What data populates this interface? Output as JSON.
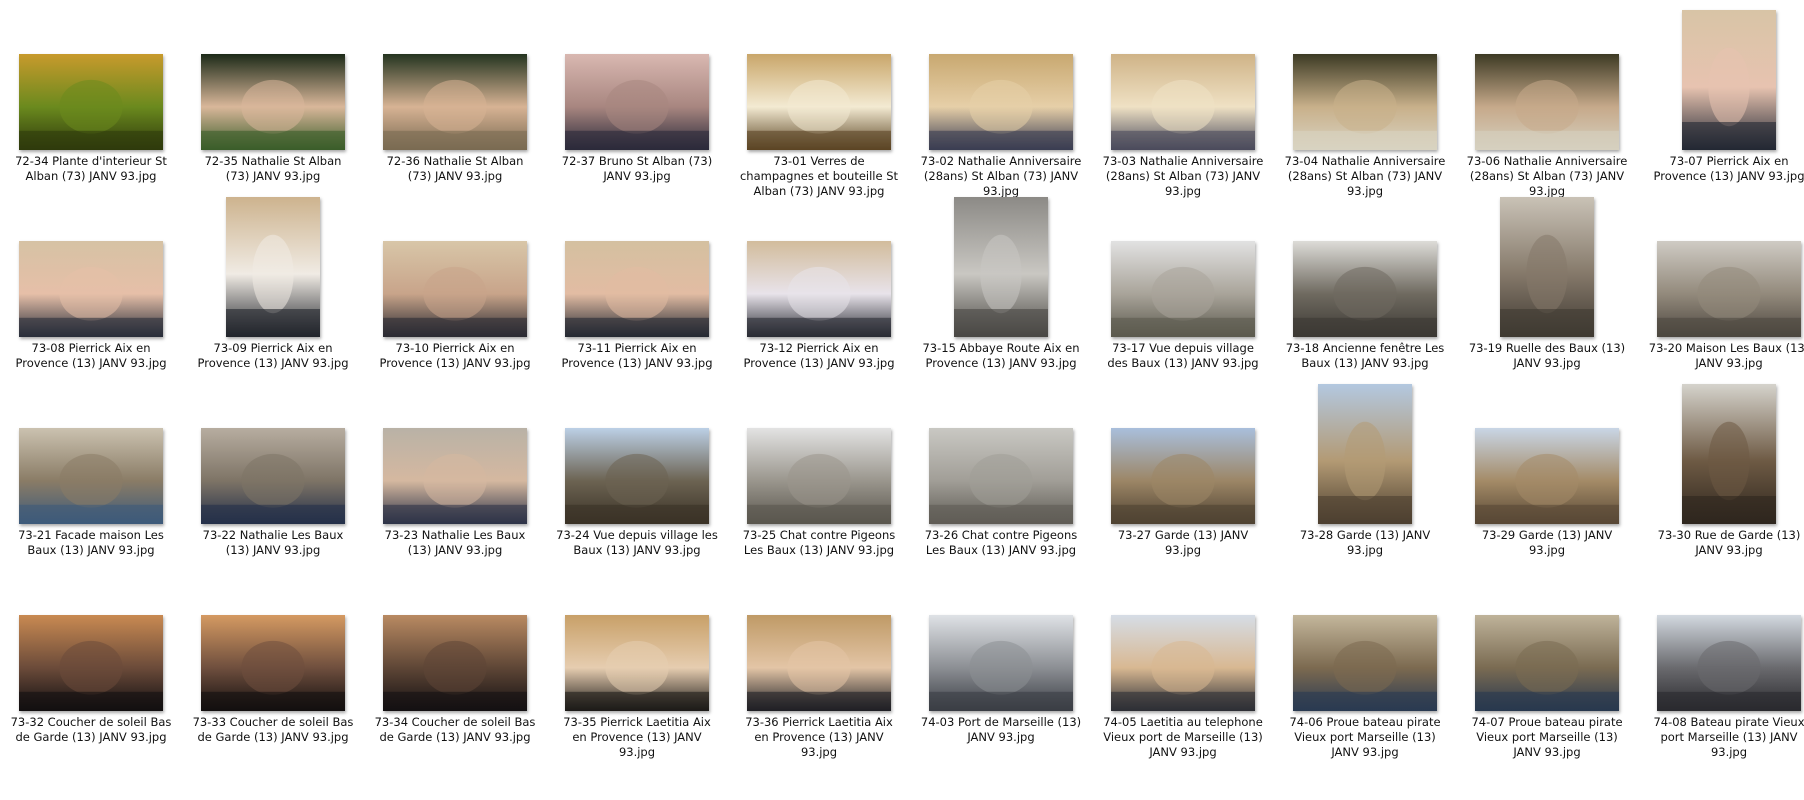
{
  "files": [
    {
      "name": "72-34 Plante d'interieur St Alban (73) JANV 93.jpg",
      "orientation": "landscape",
      "palette": [
        "#c89a2c",
        "#6b8a1e",
        "#2f3a0c"
      ]
    },
    {
      "name": "72-35 Nathalie St Alban (73) JANV 93.jpg",
      "orientation": "landscape",
      "palette": [
        "#1c2a18",
        "#d9b79a",
        "#3b5d2a"
      ]
    },
    {
      "name": "72-36 Nathalie St Alban (73) JANV 93.jpg",
      "orientation": "landscape",
      "palette": [
        "#243420",
        "#d7b394",
        "#7a6a52"
      ]
    },
    {
      "name": "72-37 Bruno St Alban (73) JANV 93.jpg",
      "orientation": "landscape",
      "palette": [
        "#d9b8b1",
        "#a88680",
        "#2b2a3a"
      ]
    },
    {
      "name": "73-01 Verres de champagnes et bouteille St Alban (73) JANV 93.jpg",
      "orientation": "landscape",
      "palette": [
        "#c9a66a",
        "#f3ead2",
        "#5b4524"
      ]
    },
    {
      "name": "73-02 Nathalie Anniversaire (28ans) St Alban (73) JANV 93.jpg",
      "orientation": "landscape",
      "palette": [
        "#c8a870",
        "#e6cfa8",
        "#3b3d52"
      ]
    },
    {
      "name": "73-03 Nathalie Anniversaire (28ans) St Alban (73) JANV 93.jpg",
      "orientation": "landscape",
      "palette": [
        "#cfb387",
        "#efe1c4",
        "#4b4b5c"
      ]
    },
    {
      "name": "73-04 Nathalie Anniversaire (28ans) St Alban (73) JANV 93.jpg",
      "orientation": "landscape",
      "palette": [
        "#3c3a24",
        "#c8b08a",
        "#d9d3c2"
      ]
    },
    {
      "name": "73-06 Nathalie Anniversaire (28ans) St Alban (73) JANV 93.jpg",
      "orientation": "landscape",
      "palette": [
        "#3d3a24",
        "#c6a98a",
        "#d6d0bf"
      ]
    },
    {
      "name": "73-07 Pierrick Aix en Provence (13) JANV 93.jpg",
      "orientation": "portrait",
      "palette": [
        "#d8c4a6",
        "#e7c3b0",
        "#232833"
      ]
    },
    {
      "name": "73-08 Pierrick Aix en Provence (13) JANV 93.jpg",
      "orientation": "landscape",
      "palette": [
        "#d6c2a4",
        "#e6bfa8",
        "#2a2f3b"
      ]
    },
    {
      "name": "73-09 Pierrick Aix en Provence (13) JANV 93.jpg",
      "orientation": "portrait",
      "palette": [
        "#cdb38e",
        "#f0ebe4",
        "#22252c"
      ]
    },
    {
      "name": "73-10 Pierrick Aix en Provence (13) JANV 93.jpg",
      "orientation": "landscape",
      "palette": [
        "#d8c6a8",
        "#c8a48a",
        "#2b2b33"
      ]
    },
    {
      "name": "73-11 Pierrick Aix en Provence (13) JANV 93.jpg",
      "orientation": "landscape",
      "palette": [
        "#d4c0a0",
        "#e2bca3",
        "#262a33"
      ]
    },
    {
      "name": "73-12 Pierrick Aix en Provence (13) JANV 93.jpg",
      "orientation": "landscape",
      "palette": [
        "#d2bc9c",
        "#e8e3ea",
        "#2a2c34"
      ]
    },
    {
      "name": "73-15 Abbaye Route Aix en Provence (13) JANV 93.jpg",
      "orientation": "portrait",
      "palette": [
        "#8c8a86",
        "#c9c7c2",
        "#4a4844"
      ]
    },
    {
      "name": "73-17 Vue depuis village des Baux (13) JANV 93.jpg",
      "orientation": "landscape",
      "palette": [
        "#e2e2e2",
        "#a9a49a",
        "#5c5a4e"
      ]
    },
    {
      "name": "73-18 Ancienne fenêtre Les Baux (13) JANV 93.jpg",
      "orientation": "landscape",
      "palette": [
        "#dddcd8",
        "#6f6a60",
        "#3c3934"
      ]
    },
    {
      "name": "73-19 Ruelle des Baux (13) JANV 93.jpg",
      "orientation": "portrait",
      "palette": [
        "#c9c2b6",
        "#85796a",
        "#3f3a32"
      ]
    },
    {
      "name": "73-20 Maison Les Baux (13) JANV 93.jpg",
      "orientation": "landscape",
      "palette": [
        "#cfcbc4",
        "#938a7c",
        "#4d4740"
      ]
    },
    {
      "name": "73-21 Facade maison Les Baux (13) JANV 93.jpg",
      "orientation": "landscape",
      "palette": [
        "#cbc2b0",
        "#8a7c66",
        "#3d5a7a"
      ]
    },
    {
      "name": "73-22 Nathalie Les Baux (13) JANV 93.jpg",
      "orientation": "landscape",
      "palette": [
        "#b7ada0",
        "#7e7466",
        "#24304a"
      ]
    },
    {
      "name": "73-23 Nathalie Les Baux (13) JANV 93.jpg",
      "orientation": "landscape",
      "palette": [
        "#b9b2a6",
        "#d5b8a0",
        "#2e3448"
      ]
    },
    {
      "name": "73-24 Vue depuis village les Baux (13) JANV 93.jpg",
      "orientation": "landscape",
      "palette": [
        "#bcd0e6",
        "#6c6352",
        "#3a3226"
      ]
    },
    {
      "name": "73-25 Chat contre Pigeons Les Baux (13) JANV 93.jpg",
      "orientation": "landscape",
      "palette": [
        "#e3e3e3",
        "#9a968d",
        "#5a564e"
      ]
    },
    {
      "name": "73-26 Chat contre Pigeons Les Baux (13) JANV 93.jpg",
      "orientation": "landscape",
      "palette": [
        "#c9c8c3",
        "#a19e97",
        "#5f5c55"
      ]
    },
    {
      "name": "73-27 Garde (13) JANV 93.jpg",
      "orientation": "landscape",
      "palette": [
        "#a9bfdc",
        "#9c8666",
        "#4f4232"
      ]
    },
    {
      "name": "73-28 Garde (13) JANV 93.jpg",
      "orientation": "portrait",
      "palette": [
        "#b3c8e0",
        "#b39a74",
        "#4d4030"
      ]
    },
    {
      "name": "73-29 Garde (13) JANV 93.jpg",
      "orientation": "landscape",
      "palette": [
        "#c9d6e6",
        "#a48b67",
        "#584836"
      ]
    },
    {
      "name": "73-30 Rue de Garde (13) JANV 93.jpg",
      "orientation": "portrait",
      "palette": [
        "#d5d3cc",
        "#6e5a44",
        "#2e261e"
      ]
    },
    {
      "name": "73-32 Coucher de soleil Bas de Garde (13) JANV 93.jpg",
      "orientation": "landscape",
      "palette": [
        "#c98a52",
        "#6b4b3a",
        "#120f10"
      ]
    },
    {
      "name": "73-33 Coucher de soleil Bas de Garde (13) JANV 93.jpg",
      "orientation": "landscape",
      "palette": [
        "#d59a62",
        "#6f4f3e",
        "#130f0f"
      ]
    },
    {
      "name": "73-34 Coucher de soleil Bas de Garde (13) JANV 93.jpg",
      "orientation": "landscape",
      "palette": [
        "#b98a62",
        "#5e4636",
        "#141012"
      ]
    },
    {
      "name": "73-35 Pierrick Laetitia Aix en Provence (13) JANV 93.jpg",
      "orientation": "landscape",
      "palette": [
        "#c8a068",
        "#e6cdb0",
        "#1d1a18"
      ]
    },
    {
      "name": "73-36 Pierrick Laetitia Aix en Provence (13) JANV 93.jpg",
      "orientation": "landscape",
      "palette": [
        "#bf9a66",
        "#e3c5a6",
        "#1f1f25"
      ]
    },
    {
      "name": "74-03 Port de Marseille (13) JANV 93.jpg",
      "orientation": "landscape",
      "palette": [
        "#dfe2e6",
        "#8c8f94",
        "#3a3d44"
      ]
    },
    {
      "name": "74-05 Laetitia au telephone Vieux port de Marseille (13) JANV 93.jpg",
      "orientation": "landscape",
      "palette": [
        "#d6dde6",
        "#d8b892",
        "#2d2f35"
      ]
    },
    {
      "name": "74-06 Proue bateau pirate Vieux port Marseille (13) JANV 93.jpg",
      "orientation": "landscape",
      "palette": [
        "#c4b79c",
        "#7c6a50",
        "#2a3a52"
      ]
    },
    {
      "name": "74-07 Proue bateau pirate Vieux port Marseille (13) JANV 93.jpg",
      "orientation": "landscape",
      "palette": [
        "#bfb39a",
        "#7a6b52",
        "#28384f"
      ]
    },
    {
      "name": "74-08 Bateau pirate Vieux port Marseille (13) JANV 93.jpg",
      "orientation": "landscape",
      "palette": [
        "#d3d9e0",
        "#6a6a6e",
        "#2a2a2e"
      ]
    }
  ]
}
